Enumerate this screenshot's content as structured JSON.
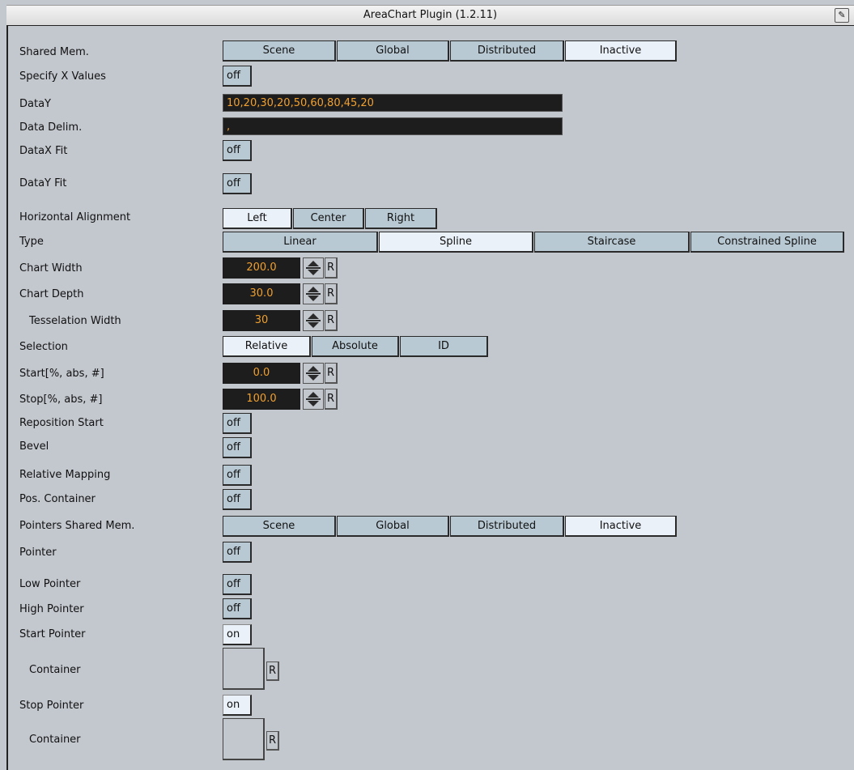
{
  "window": {
    "title": "AreaChart Plugin (1.2.11)",
    "icon": "plugin-help-icon"
  },
  "colors": {
    "field_bg": "#1d1d1d",
    "field_text": "#f0a030",
    "button_bg": "#b8c9d3",
    "button_active_bg": "#eaf1f9",
    "panel_bg": "#c3c7ce"
  },
  "rows": {
    "shared_mem": {
      "label": "Shared Mem.",
      "options": [
        "Scene",
        "Global",
        "Distributed",
        "Inactive"
      ],
      "selected": "Inactive"
    },
    "specify_x": {
      "label": "Specify X Values",
      "value": "off"
    },
    "data_y": {
      "label": "DataY",
      "value": "10,20,30,20,50,60,80,45,20"
    },
    "data_delim": {
      "label": "Data Delim.",
      "value": ","
    },
    "datax_fit": {
      "label": "DataX Fit",
      "value": "off"
    },
    "datay_fit": {
      "label": "DataY Fit",
      "value": "off"
    },
    "h_align": {
      "label": "Horizontal Alignment",
      "options": [
        "Left",
        "Center",
        "Right"
      ],
      "selected": "Left"
    },
    "type": {
      "label": "Type",
      "options": [
        "Linear",
        "Spline",
        "Staircase",
        "Constrained Spline"
      ],
      "selected": "Spline"
    },
    "chart_width": {
      "label": "Chart Width",
      "value": "200.0",
      "reset": "R"
    },
    "chart_depth": {
      "label": "Chart Depth",
      "value": "30.0",
      "reset": "R"
    },
    "tess_width": {
      "label": "Tesselation Width",
      "value": "30",
      "reset": "R"
    },
    "selection": {
      "label": "Selection",
      "options": [
        "Relative",
        "Absolute",
        "ID"
      ],
      "selected": "Relative"
    },
    "start": {
      "label": "Start[%, abs, #]",
      "value": "0.0",
      "reset": "R"
    },
    "stop": {
      "label": "Stop[%, abs, #]",
      "value": "100.0",
      "reset": "R"
    },
    "reposition_start": {
      "label": "Reposition Start",
      "value": "off"
    },
    "bevel": {
      "label": "Bevel",
      "value": "off"
    },
    "relative_mapping": {
      "label": "Relative Mapping",
      "value": "off"
    },
    "pos_container": {
      "label": "Pos. Container",
      "value": "off"
    },
    "pointers_shared_mem": {
      "label": "Pointers Shared Mem.",
      "options": [
        "Scene",
        "Global",
        "Distributed",
        "Inactive"
      ],
      "selected": "Inactive"
    },
    "pointer": {
      "label": "Pointer",
      "value": "off"
    },
    "low_pointer": {
      "label": "Low Pointer",
      "value": "off"
    },
    "high_pointer": {
      "label": "High Pointer",
      "value": "off"
    },
    "start_pointer": {
      "label": "Start Pointer",
      "value": "on"
    },
    "start_container": {
      "label": "Container",
      "reset": "R"
    },
    "stop_pointer": {
      "label": "Stop Pointer",
      "value": "on"
    },
    "stop_container": {
      "label": "Container",
      "reset": "R"
    }
  }
}
